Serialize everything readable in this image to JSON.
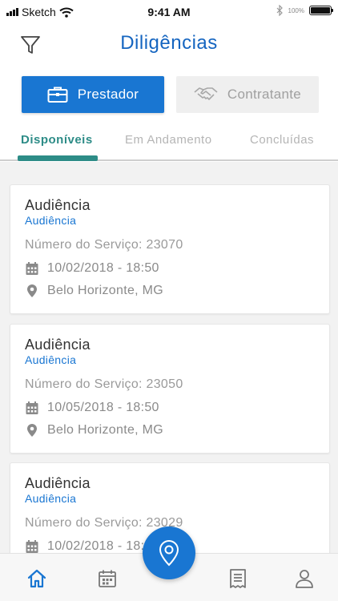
{
  "status_bar": {
    "carrier": "Sketch",
    "time": "9:41 AM",
    "battery_percent": "100%"
  },
  "header": {
    "title": "Diligências",
    "filter_icon": "filter-icon"
  },
  "role_toggle": {
    "prestador_label": "Prestador",
    "contratante_label": "Contratante"
  },
  "tabs": [
    {
      "label": "Disponíveis",
      "active": true
    },
    {
      "label": "Em Andamento",
      "active": false
    },
    {
      "label": "Concluídas",
      "active": false
    }
  ],
  "cards": [
    {
      "title": "Audiência",
      "subtitle": "Audiência",
      "service": "Número do Serviço: 23070",
      "datetime": "10/02/2018 - 18:50",
      "location": "Belo Horizonte, MG"
    },
    {
      "title": "Audiência",
      "subtitle": "Audiência",
      "service": "Número do Serviço: 23050",
      "datetime": "10/05/2018 - 18:50",
      "location": "Belo Horizonte, MG"
    },
    {
      "title": "Audiência",
      "subtitle": "Audiência",
      "service": "Número do Serviço: 23029",
      "datetime": "10/02/2018 - 18:50",
      "location": ""
    }
  ],
  "bottom_nav": {
    "items": [
      "home-icon",
      "calendar-icon",
      "map-pin-icon",
      "receipt-icon",
      "user-icon"
    ],
    "active": "home-icon"
  },
  "colors": {
    "primary": "#1976d2",
    "title_blue": "#1565c0",
    "tab_active": "#2d8c87",
    "muted": "#9a9a9a"
  }
}
